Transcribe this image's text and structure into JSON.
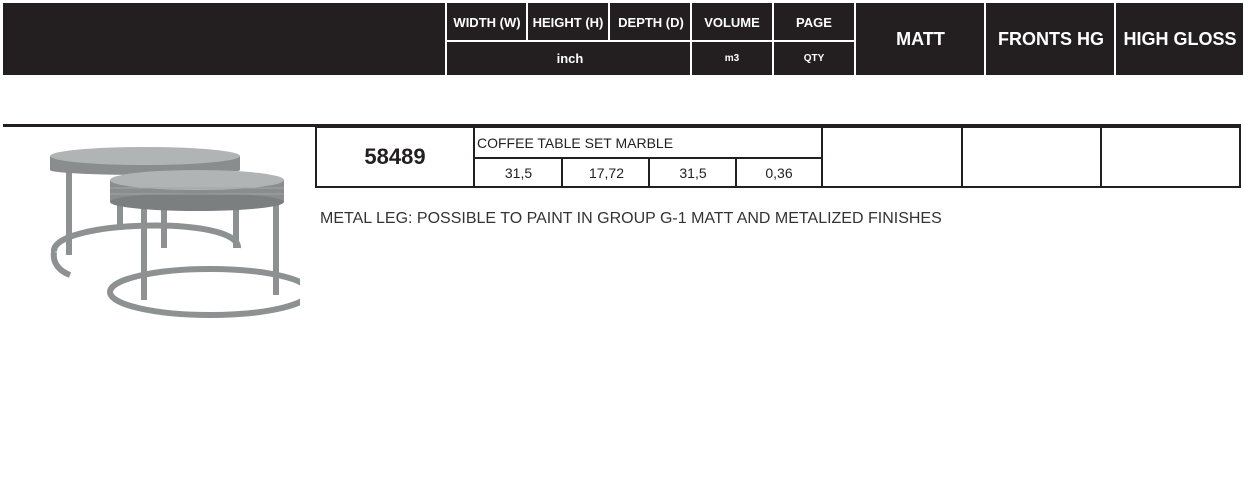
{
  "header": {
    "width_label": "WIDTH (W)",
    "height_label": "HEIGHT (H)",
    "depth_label": "DEPTH (D)",
    "volume_label": "VOLUME",
    "page_label": "PAGE",
    "unit_inch": "inch",
    "unit_m3": "m3",
    "unit_qty": "QTY",
    "matt_label": "MATT",
    "fronts_hg_label": "FRONTS HG",
    "high_gloss_label": "HIGH GLOSS"
  },
  "product": {
    "code": "58489",
    "name": "COFFEE TABLE SET MARBLE",
    "width": "31,5",
    "height": "17,72",
    "depth": "31,5",
    "volume": "0,36",
    "note": "METAL LEG: POSSIBLE TO PAINT IN GROUP G-1 MATT AND METALIZED FINISHES"
  },
  "colors": {
    "header_bg": "#231f20",
    "header_text": "#ffffff",
    "frame": "#8e9192"
  }
}
